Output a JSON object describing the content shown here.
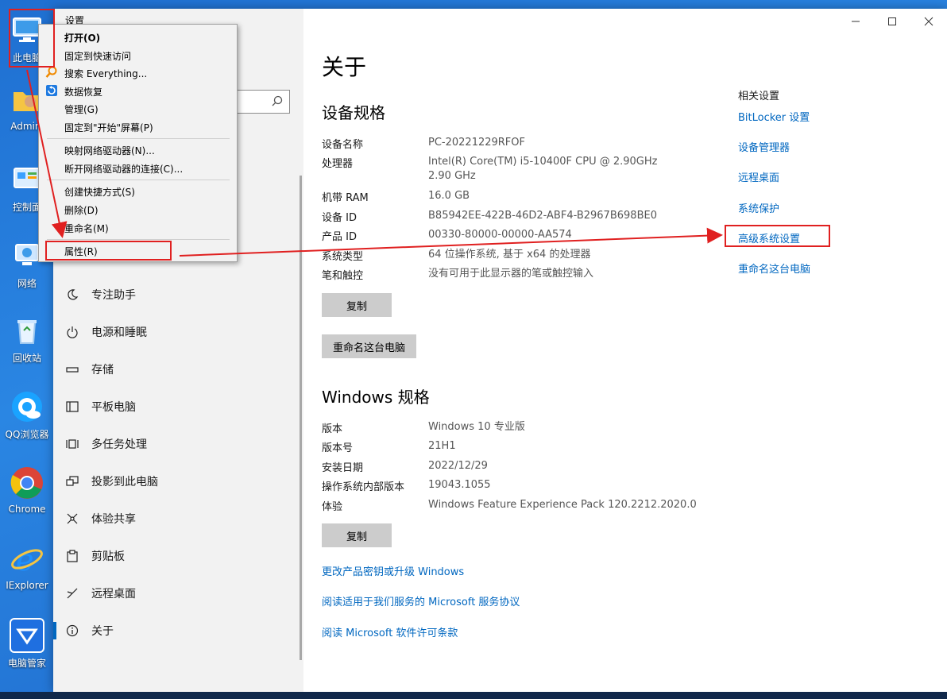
{
  "desktop": {
    "icons": [
      {
        "label": "此电脑",
        "icon": "computer-icon"
      },
      {
        "label": "Admini",
        "icon": "folder-icon"
      },
      {
        "label": "控制面",
        "icon": "control-panel-icon"
      },
      {
        "label": "网络",
        "icon": "network-icon"
      },
      {
        "label": "回收站",
        "icon": "recycle-bin-icon"
      },
      {
        "label": "QQ浏览器",
        "icon": "qq-browser-icon"
      },
      {
        "label": "Chrome",
        "icon": "chrome-icon"
      },
      {
        "label": "IExplorer",
        "icon": "ie-icon"
      },
      {
        "label": "电脑管家",
        "icon": "pc-manager-icon"
      }
    ]
  },
  "window": {
    "app_title": "设置",
    "nav": [
      {
        "label": "专注助手",
        "icon": "moon-icon"
      },
      {
        "label": "电源和睡眠",
        "icon": "power-icon"
      },
      {
        "label": "存储",
        "icon": "storage-icon"
      },
      {
        "label": "平板电脑",
        "icon": "tablet-icon"
      },
      {
        "label": "多任务处理",
        "icon": "multitask-icon"
      },
      {
        "label": "投影到此电脑",
        "icon": "project-icon"
      },
      {
        "label": "体验共享",
        "icon": "share-icon"
      },
      {
        "label": "剪贴板",
        "icon": "clipboard-icon"
      },
      {
        "label": "远程桌面",
        "icon": "remote-desktop-icon"
      },
      {
        "label": "关于",
        "icon": "info-icon"
      }
    ],
    "page_title": "关于",
    "device_spec": {
      "heading": "设备规格",
      "rows": [
        {
          "key": "设备名称",
          "value": "PC-20221229RFOF"
        },
        {
          "key": "处理器",
          "value": "Intel(R) Core(TM) i5-10400F CPU @ 2.90GHz   2.90 GHz"
        },
        {
          "key": "机带 RAM",
          "value": "16.0 GB"
        },
        {
          "key": "设备 ID",
          "value": "B85942EE-422B-46D2-ABF4-B2967B698BE0"
        },
        {
          "key": "产品 ID",
          "value": "00330-80000-00000-AA574"
        },
        {
          "key": "系统类型",
          "value": "64 位操作系统, 基于 x64 的处理器"
        },
        {
          "key": "笔和触控",
          "value": "没有可用于此显示器的笔或触控输入"
        }
      ],
      "copy_label": "复制",
      "rename_label": "重命名这台电脑"
    },
    "windows_spec": {
      "heading": "Windows 规格",
      "rows": [
        {
          "key": "版本",
          "value": "Windows 10 专业版"
        },
        {
          "key": "版本号",
          "value": "21H1"
        },
        {
          "key": "安装日期",
          "value": "2022/12/29"
        },
        {
          "key": "操作系统内部版本",
          "value": "19043.1055"
        },
        {
          "key": "体验",
          "value": "Windows Feature Experience Pack 120.2212.2020.0"
        }
      ],
      "copy_label": "复制"
    },
    "links": [
      "更改产品密钥或升级 Windows",
      "阅读适用于我们服务的 Microsoft 服务协议",
      "阅读 Microsoft 软件许可条款"
    ],
    "related": {
      "title": "相关设置",
      "links": [
        "BitLocker 设置",
        "设备管理器",
        "远程桌面",
        "系统保护",
        "高级系统设置",
        "重命名这台电脑"
      ]
    }
  },
  "context_menu": {
    "items": [
      {
        "label": "打开(O)",
        "bold": true
      },
      {
        "label": "固定到快速访问"
      },
      {
        "label": "搜索 Everything...",
        "icon": "everything-search-icon"
      },
      {
        "label": "数据恢复",
        "icon": "data-recovery-icon"
      },
      {
        "label": "管理(G)"
      },
      {
        "label": "固定到\"开始\"屏幕(P)"
      },
      {
        "label": "映射网络驱动器(N)..."
      },
      {
        "label": "断开网络驱动器的连接(C)..."
      },
      {
        "label": "创建快捷方式(S)"
      },
      {
        "label": "删除(D)"
      },
      {
        "label": "重命名(M)"
      },
      {
        "label": "属性(R)"
      }
    ]
  },
  "colors": {
    "accent": "#0067c0",
    "annotation": "#e02020",
    "desktop": "#2a86e3"
  }
}
